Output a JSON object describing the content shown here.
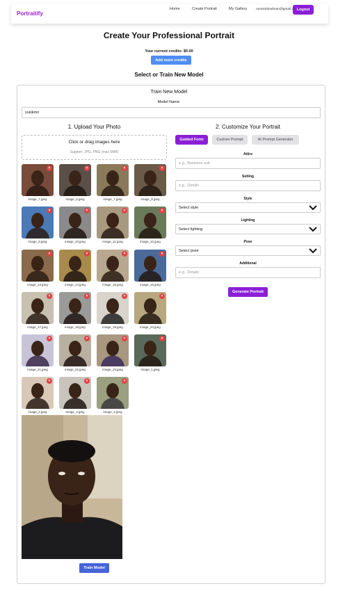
{
  "nav": {
    "brand": "Portraitify",
    "links": [
      "Home",
      "Create Portrait",
      "My Gallery"
    ],
    "email": "nomisinbadman@gmail.com",
    "logout": "Logout"
  },
  "page": {
    "title": "Create Your Professional Portrait",
    "credits": "Your current credits: $0.00",
    "add_credits": "Add more credits",
    "section_title": "Select or Train New Model"
  },
  "train": {
    "title": "Train New Model",
    "model_name_label": "Model Name:",
    "model_name_value": "yusikmn",
    "upload_heading": "1. Upload Your Photo",
    "dropzone_text": "Click or drag images here",
    "dropzone_hint": "Support: JPG, PNG (max 5MB)",
    "images": [
      "image_7.jpeg",
      "image_6.jpeg",
      "image_7.jpeg",
      "image_8.jpeg",
      "image_9.jpeg",
      "image_10.jpeg",
      "image_11.jpeg",
      "image_12.jpeg",
      "image_13.jpeg",
      "image_14.jpeg",
      "image_15.jpeg",
      "image_16.jpeg",
      "image_17.jpeg",
      "image_18.jpeg",
      "image_19.jpeg",
      "image_20.jpeg",
      "image_21.jpeg",
      "image_22.jpeg",
      "image_23.jpeg",
      "image_1.jpeg",
      "image_2.jpeg",
      "image_3.jpeg",
      "image_4.jpeg"
    ],
    "train_button": "Train Model"
  },
  "customize": {
    "heading": "2. Customize Your Portrait",
    "tabs": [
      "Guided Form",
      "Custom Prompt",
      "AI Prompt Generator"
    ],
    "attire_label": "Attire",
    "attire_placeholder": "e.g., Business suit",
    "setting_label": "Setting",
    "setting_placeholder": "e.g., Details",
    "style_label": "Style",
    "style_value": "Select style",
    "lighting_label": "Lighting",
    "lighting_value": "Select lighting",
    "pose_label": "Pose",
    "pose_value": "Select pose",
    "additional_label": "Additional",
    "additional_placeholder": "e.g., Details",
    "generate_button": "Generate Portrait"
  },
  "colors": {
    "brand": "#9b1fd0",
    "primary": "#8b1fd6",
    "credits_button": "#4f8df5",
    "train_button": "#4564d8",
    "remove_badge": "#e04444"
  }
}
